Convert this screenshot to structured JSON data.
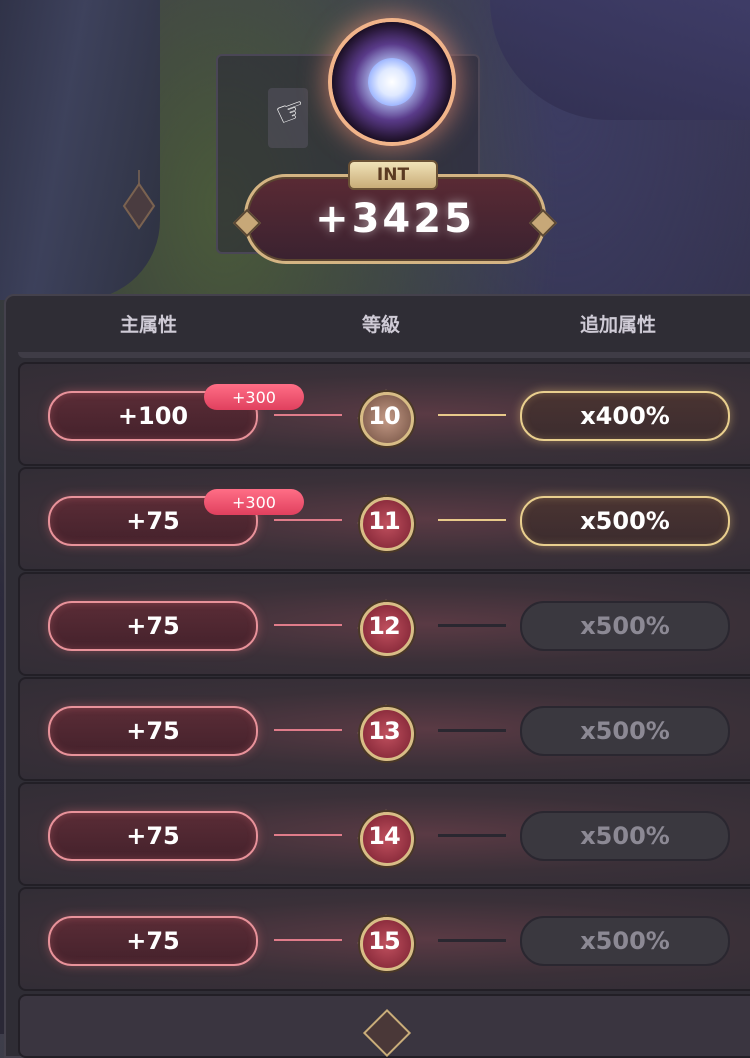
{
  "stat": {
    "label": "INT",
    "value": "+3425"
  },
  "columns": {
    "main": "主属性",
    "level": "等級",
    "bonus": "追加属性"
  },
  "rows": [
    {
      "main": "+100",
      "badge": "+300",
      "level": "10",
      "bonus": "x400%",
      "active": true
    },
    {
      "main": "+75",
      "badge": "+300",
      "level": "11",
      "bonus": "x500%",
      "active": true
    },
    {
      "main": "+75",
      "badge": "",
      "level": "12",
      "bonus": "x500%",
      "active": false
    },
    {
      "main": "+75",
      "badge": "",
      "level": "13",
      "bonus": "x500%",
      "active": false
    },
    {
      "main": "+75",
      "badge": "",
      "level": "14",
      "bonus": "x500%",
      "active": false
    },
    {
      "main": "+75",
      "badge": "",
      "level": "15",
      "bonus": "x500%",
      "active": false
    }
  ],
  "colors": {
    "main_border": "#e8929a",
    "bonus_active": "#e9cf8e",
    "badge": "#ff6e86",
    "level_gold": "#d8bd86"
  },
  "icons": {
    "cursor": "pointing-hand-icon",
    "orb": "crystal-orb-icon"
  }
}
